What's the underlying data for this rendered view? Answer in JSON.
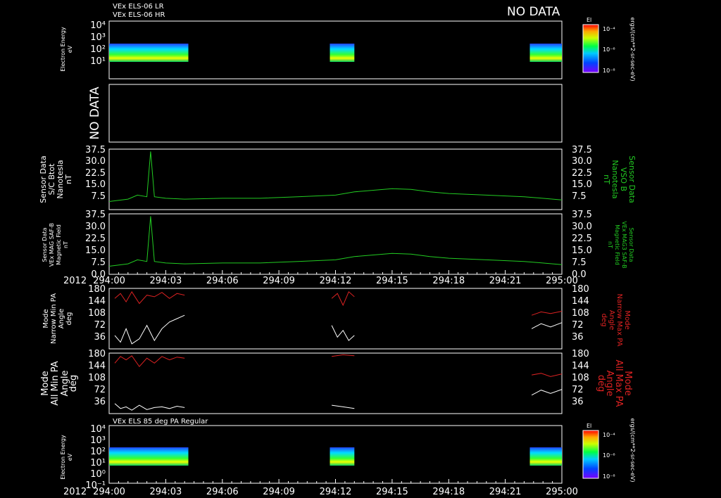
{
  "header": {
    "line1": "VEx ELS-06 LR",
    "line2": "VEx ELS-06 HR",
    "no_data": "NO DATA"
  },
  "colorbar_top": {
    "label": "El",
    "ticks": [
      "10⁻⁴",
      "10⁻⁶",
      "10⁻⁸"
    ]
  },
  "colorbar_bottom": {
    "label": "El",
    "ticks": [
      "10⁻⁴",
      "10⁻⁶",
      "10⁻⁸"
    ]
  },
  "colorbar_units": "ergs/(cm**2-sr-sec-eV)",
  "panel1": {
    "ylabel1": "Electron Energy",
    "ylabel2": "eV",
    "yticks": [
      "10⁴",
      "10³",
      "10²",
      "10¹"
    ]
  },
  "panel2": {
    "no_data": "NO DATA"
  },
  "panel3": {
    "left_label": [
      "Sensor Data",
      "S/C Btot",
      "Nanotesla",
      "nT"
    ],
    "right_label": [
      "Sensor Data",
      "VSO B",
      "Nanotesla",
      "nT"
    ],
    "yticks": [
      "37.5",
      "30.0",
      "22.5",
      "15.0",
      "7.5"
    ]
  },
  "panel4": {
    "left_label": [
      "Sensor Data",
      "VEx MAG SAF-B",
      "Magnetic Field",
      "nT"
    ],
    "right_label": [
      "Sensor Data",
      "VEx MAG3 SAF-B",
      "Magnetic Field",
      "nT"
    ],
    "yticks": [
      "37.5",
      "30.0",
      "22.5",
      "15.0",
      "7.5",
      "0.0"
    ]
  },
  "panel5": {
    "left_label": [
      "Mode",
      "Narrow Min PA",
      "Angle",
      "deg"
    ],
    "right_label": [
      "Mode",
      "Narrow Max PA",
      "Angle",
      "deg"
    ],
    "yticks": [
      "180",
      "144",
      "108",
      "72",
      "36"
    ]
  },
  "panel6": {
    "left_label": [
      "Mode",
      "All Min PA",
      "Angle",
      "deg"
    ],
    "right_label": [
      "Mode",
      "All Max PA",
      "Angle",
      "deg"
    ],
    "yticks": [
      "180",
      "144",
      "108",
      "72",
      "36"
    ]
  },
  "panel7": {
    "title": "VEx ELS 85 deg PA Regular",
    "ylabel1": "Electron Energy",
    "ylabel2": "eV",
    "yticks": [
      "10⁴",
      "10³",
      "10²",
      "10¹",
      "10⁰",
      "10⁻¹"
    ]
  },
  "time_axis": {
    "year": "2012",
    "labels": [
      "294:00",
      "294:03",
      "294:06",
      "294:09",
      "294:12",
      "294:15",
      "294:18",
      "294:21",
      "295:00"
    ]
  },
  "colors": {
    "mag": "#22cc22",
    "max_pa": "#dd2222",
    "min_pa": "#ffffff"
  },
  "chart_data": [
    {
      "type": "heatmap",
      "ylabel": "Electron Energy eV",
      "yscale": "log",
      "x_range_hours": [
        0,
        24
      ],
      "data_intervals_hours": [
        [
          0.0,
          4.2
        ],
        [
          11.7,
          13.0
        ],
        [
          22.3,
          24.0
        ]
      ]
    },
    {
      "type": "line",
      "title": "NO DATA"
    },
    {
      "type": "line",
      "ylabel": "Sensor Data S/C Btot Nanotesla nT",
      "ylim": [
        0,
        37.5
      ],
      "x": [
        0,
        1,
        1.5,
        2,
        2.2,
        2.4,
        3,
        4,
        6,
        8,
        10,
        12,
        13,
        14,
        15,
        16,
        17,
        18,
        20,
        22,
        24
      ],
      "values": [
        5,
        6.5,
        9,
        8,
        36,
        8,
        7,
        6.5,
        7,
        7,
        8,
        9,
        11,
        12,
        13,
        12.5,
        11,
        10,
        9,
        8,
        6
      ]
    },
    {
      "type": "line",
      "ylabel": "Sensor Data VEx MAG SAF-B Magnetic Field nT",
      "ylim": [
        0,
        37.5
      ],
      "x": [
        0,
        1,
        1.5,
        2,
        2.2,
        2.4,
        3,
        4,
        6,
        8,
        10,
        12,
        13,
        14,
        15,
        16,
        17,
        18,
        20,
        22,
        24
      ],
      "values": [
        5,
        6.5,
        9,
        8,
        36,
        8,
        7,
        6.5,
        7,
        7,
        8,
        9,
        11,
        12,
        13,
        12.5,
        11,
        10,
        9,
        8,
        6
      ]
    },
    {
      "type": "line",
      "ylabel": "Mode Narrow Min/Max PA Angle deg",
      "ylim": [
        0,
        180
      ],
      "series": [
        {
          "name": "Max PA",
          "x": [
            0.3,
            0.6,
            0.9,
            1.2,
            1.6,
            2.0,
            2.4,
            2.8,
            3.2,
            3.6,
            4.0,
            11.8,
            12.1,
            12.4,
            12.7,
            13.0,
            22.4,
            22.9,
            23.4,
            24.0
          ],
          "values": [
            150,
            165,
            140,
            170,
            135,
            160,
            155,
            168,
            150,
            165,
            160,
            150,
            165,
            130,
            170,
            155,
            100,
            110,
            105,
            112
          ]
        },
        {
          "name": "Min PA",
          "x": [
            0.3,
            0.6,
            0.9,
            1.2,
            1.6,
            2.0,
            2.4,
            2.8,
            3.2,
            3.6,
            4.0,
            11.8,
            12.1,
            12.4,
            12.7,
            13.0,
            22.4,
            22.9,
            23.4,
            24.0
          ],
          "values": [
            40,
            20,
            60,
            15,
            30,
            70,
            25,
            60,
            80,
            90,
            100,
            70,
            35,
            55,
            25,
            40,
            60,
            75,
            65,
            78
          ]
        }
      ]
    },
    {
      "type": "line",
      "ylabel": "Mode All Min/Max PA Angle deg",
      "ylim": [
        0,
        180
      ],
      "series": [
        {
          "name": "Max PA",
          "x": [
            0.3,
            0.6,
            0.9,
            1.2,
            1.6,
            2.0,
            2.4,
            2.8,
            3.2,
            3.6,
            4.0,
            11.8,
            12.4,
            13.0,
            22.4,
            22.9,
            23.4,
            24.0
          ],
          "values": [
            150,
            170,
            160,
            172,
            140,
            165,
            150,
            170,
            160,
            168,
            165,
            170,
            175,
            172,
            115,
            120,
            110,
            118
          ]
        },
        {
          "name": "Min PA",
          "x": [
            0.3,
            0.6,
            0.9,
            1.2,
            1.6,
            2.0,
            2.4,
            2.8,
            3.2,
            3.6,
            4.0,
            11.8,
            12.4,
            13.0,
            22.4,
            22.9,
            23.4,
            24.0
          ],
          "values": [
            30,
            15,
            20,
            10,
            25,
            12,
            18,
            20,
            15,
            22,
            18,
            25,
            20,
            15,
            55,
            70,
            60,
            72
          ]
        }
      ]
    },
    {
      "type": "heatmap",
      "title": "VEx ELS 85 deg PA Regular",
      "ylabel": "Electron Energy eV",
      "yscale": "log",
      "x_range_hours": [
        0,
        24
      ],
      "data_intervals_hours": [
        [
          0.0,
          4.2
        ],
        [
          11.7,
          13.0
        ],
        [
          22.3,
          24.0
        ]
      ]
    }
  ]
}
